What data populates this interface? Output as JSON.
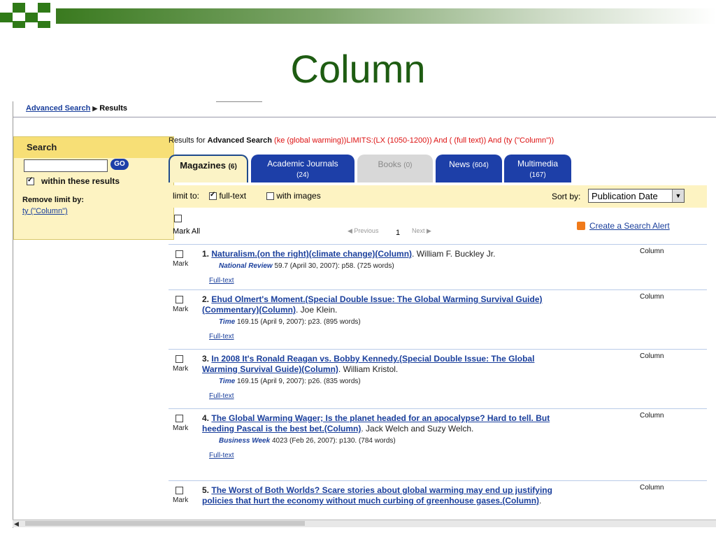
{
  "slide": {
    "title": "Column"
  },
  "breadcrumb": {
    "link": "Advanced Search",
    "separator": "▶",
    "current": "Results"
  },
  "sidebar": {
    "heading": "Search",
    "go_label": "GO",
    "within_label": "within these results",
    "remove_limit_label": "Remove limit by:",
    "remove_limit_link": "ty (\"Column\")"
  },
  "results_header": {
    "prefix": "Results for ",
    "search_type": "Advanced Search",
    "query": " (ke (global warming))LIMITS:(LX (1050-1200)) And ( (full text)) And (ty (\"Column\"))"
  },
  "tabs": [
    {
      "label": "Magazines",
      "count": "(6)"
    },
    {
      "label": "Academic Journals",
      "count": "(24)"
    },
    {
      "label": "Books",
      "count": "(0)"
    },
    {
      "label": "News",
      "count": "(604)"
    },
    {
      "label": "Multimedia",
      "count": "(167)"
    }
  ],
  "limits": {
    "label": "limit to:",
    "full_text": "full-text",
    "with_images": "with images",
    "sort_label": "Sort by:",
    "sort_value": "Publication Date"
  },
  "nav": {
    "mark_all": "Mark All",
    "previous": "◀ Previous",
    "page": "1",
    "next": "Next ▶",
    "create_alert": "Create a Search Alert"
  },
  "results": [
    {
      "num": "1.",
      "title": "Naturalism.(on the right)(climate change)(Column)",
      "author": ". William F. Buckley Jr.",
      "publication": "National Review",
      "source": " 59.7 (April 30, 2007): p58. (725 words)",
      "link": "Full-text",
      "type": "Column",
      "mark": "Mark"
    },
    {
      "num": "2.",
      "title": "Ehud Olmert's Moment.(Special Double Issue: The Global Warming Survival Guide)(Commentary)(Column)",
      "author": ". Joe Klein.",
      "publication": "Time",
      "source": " 169.15 (April 9, 2007): p23. (895 words)",
      "link": "Full-text",
      "type": "Column",
      "mark": "Mark"
    },
    {
      "num": "3.",
      "title": "In 2008 It's Ronald Reagan vs. Bobby Kennedy.(Special Double Issue: The Global Warming Survival Guide)(Column)",
      "author": ". William Kristol.",
      "publication": "Time",
      "source": " 169.15 (April 9, 2007): p26. (835 words)",
      "link": "Full-text",
      "type": "Column",
      "mark": "Mark"
    },
    {
      "num": "4.",
      "title": "The Global Warming Wager; Is the planet headed for an apocalypse? Hard to tell. But heeding Pascal is the best bet.(Column)",
      "author": ". Jack Welch and Suzy Welch.",
      "publication": "Business Week",
      "source": " 4023 (Feb 26, 2007): p130. (784 words)",
      "link": "Full-text",
      "type": "Column",
      "mark": "Mark"
    },
    {
      "num": "5.",
      "title": "The Worst of Both Worlds? Scare stories about global warming may end up justifying policies that hurt the economy without much curbing of greenhouse gases.(Column)",
      "author": ".",
      "type": "Column",
      "mark": "Mark"
    }
  ]
}
